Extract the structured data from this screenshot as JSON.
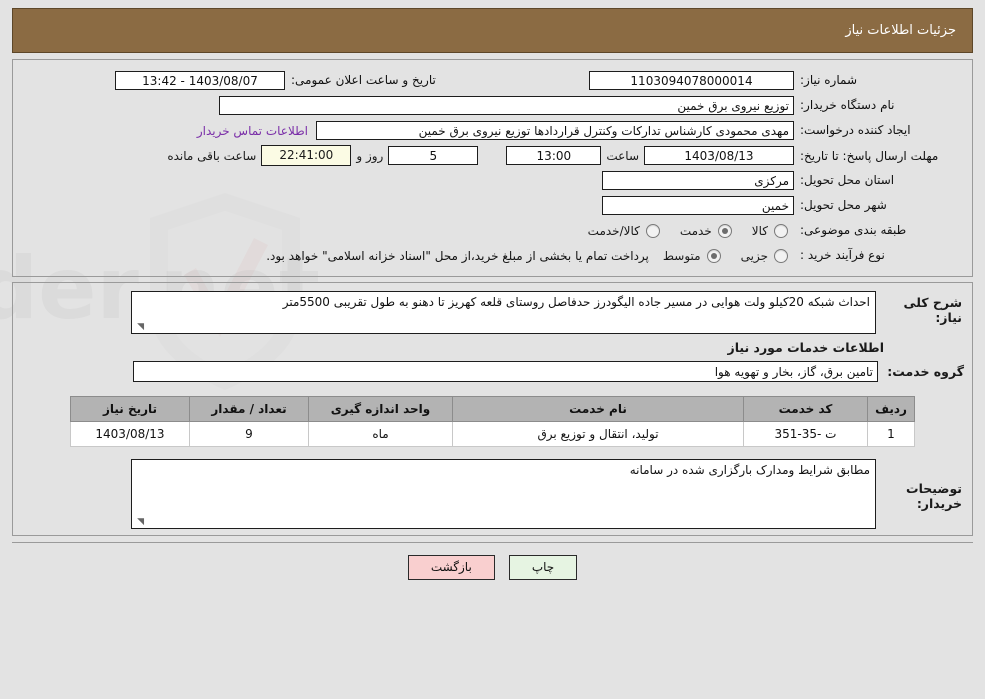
{
  "header": {
    "title": "جزئیات اطلاعات نیاز"
  },
  "top": {
    "need_number_label": "شماره نیاز:",
    "need_number_value": "1103094078000014",
    "announce_label": "تاریخ و ساعت اعلان عمومی:",
    "announce_value": "1403/08/07 - 13:42",
    "buyer_org_label": "نام دستگاه خریدار:",
    "buyer_org_value": "توزیع نیروی برق خمین",
    "creator_label": "ایجاد کننده درخواست:",
    "creator_value": "مهدی محمودی کارشناس تدارکات وکنترل قراردادها توزیع نیروی برق خمین",
    "contact_link": "اطلاعات تماس خریدار",
    "deadline_label": "مهلت ارسال پاسخ: تا تاریخ:",
    "deadline_date": "1403/08/13",
    "hour_label": "ساعت",
    "deadline_time": "13:00",
    "days_remaining": "5",
    "days_label": "روز و",
    "countdown": "22:41:00",
    "remaining_label": "ساعت باقی مانده",
    "province_label": "استان محل تحویل:",
    "province_value": "مرکزی",
    "city_label": "شهر محل تحویل:",
    "city_value": "خمین",
    "category_label": "طبقه بندی موضوعی:",
    "category_options": [
      {
        "label": "کالا",
        "selected": false
      },
      {
        "label": "خدمت",
        "selected": true
      },
      {
        "label": "کالا/خدمت",
        "selected": false
      }
    ],
    "process_label": "نوع فرآیند خرید :",
    "process_options": [
      {
        "label": "جزیی",
        "selected": false
      },
      {
        "label": "متوسط",
        "selected": true
      }
    ],
    "process_note": "پرداخت تمام یا بخشی از مبلغ خرید،از محل \"اسناد خزانه اسلامی\" خواهد بود."
  },
  "description": {
    "label": "شرح کلی نیاز:",
    "value": "احداث شبکه 20کیلو ولت هوایی در مسیر جاده الیگودرز حدفاصل روستای قلعه کهریز تا دهنو به طول تقریبی 5500متر"
  },
  "services": {
    "section_title": "اطلاعات خدمات مورد نیاز",
    "group_label": "گروه خدمت:",
    "group_value": "تامین برق، گاز، بخار و تهویه هوا",
    "table": {
      "columns": [
        "ردیف",
        "کد خدمت",
        "نام خدمت",
        "واحد اندازه گیری",
        "تعداد / مقدار",
        "تاریخ نیاز"
      ],
      "rows": [
        {
          "index": "1",
          "code": "ت -35-351",
          "name": "تولید، انتقال و توزیع برق",
          "unit": "ماه",
          "quantity": "9",
          "date": "1403/08/13"
        }
      ]
    }
  },
  "buyer_notes": {
    "label": "توضیحات خریدار:",
    "value": "مطابق شرایط ومدارک بارگزاری شده در سامانه"
  },
  "footer": {
    "print_label": "چاپ",
    "back_label": "بازگشت"
  },
  "colors": {
    "header_bg": "#8b6b43",
    "link": "#7a2ea8",
    "countdown_bg": "#fbfbe4",
    "back_btn": "#f9cfcf",
    "print_btn": "#e6f4e2"
  }
}
